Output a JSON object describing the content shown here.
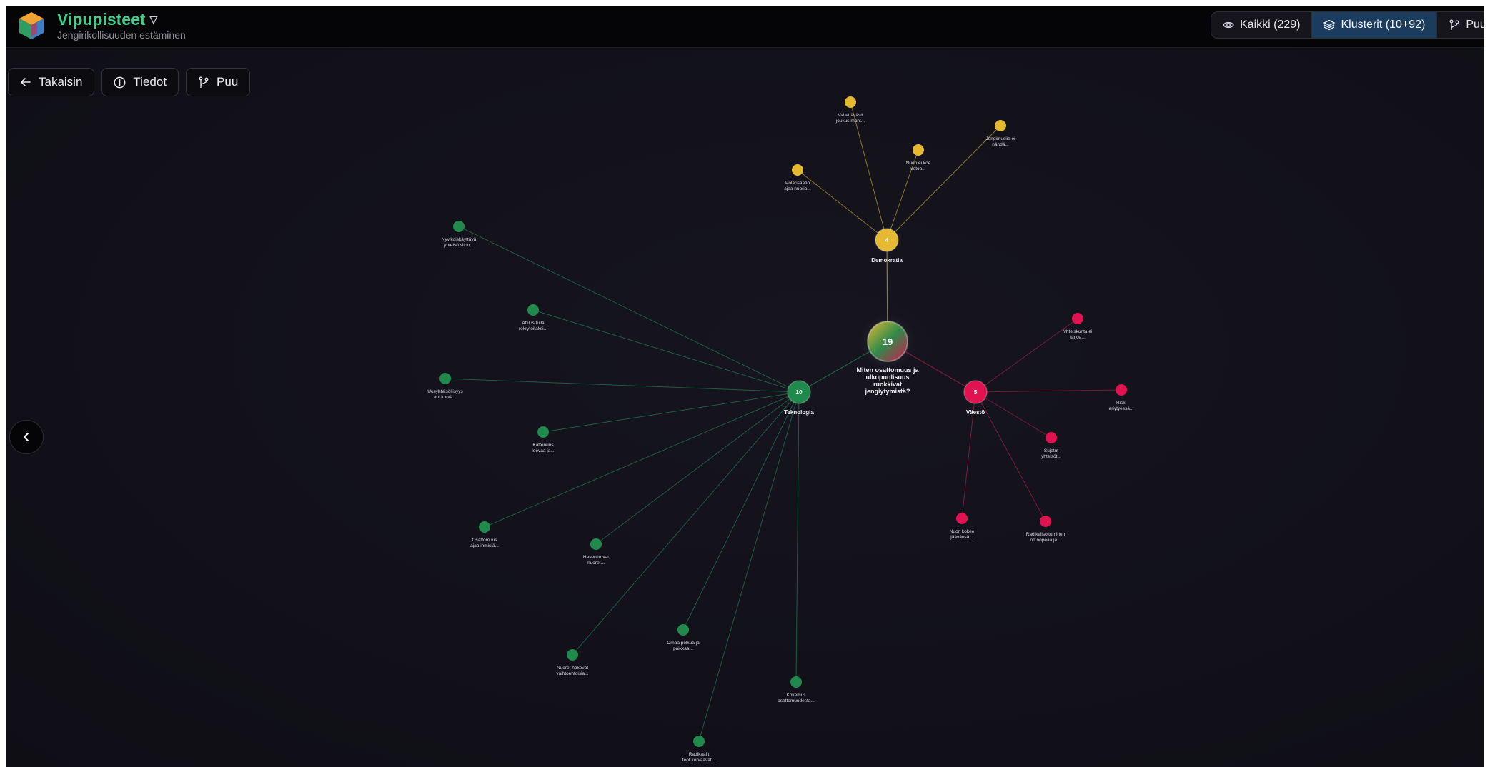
{
  "header": {
    "title": "Vipupisteet",
    "subtitle": "Jengirikollisuuden estäminen"
  },
  "view_tabs": [
    {
      "label": "Kaikki (229)",
      "icon": "eye-icon",
      "active": false
    },
    {
      "label": "Klusterit (10+92)",
      "icon": "layers-icon",
      "active": true
    },
    {
      "label": "Puun",
      "icon": "git-branch-icon",
      "active": false
    }
  ],
  "toolbar": {
    "back_label": "Takaisin",
    "info_label": "Tiedot",
    "tree_label": "Puu"
  },
  "side_toggle": {
    "icon": "chevron-left-icon"
  },
  "colors": {
    "demokratia": "#e6b933",
    "teknologia": "#1f8a4c",
    "vaesto": "#e0124f",
    "edge_green": "#1e6b48",
    "edge_yellow": "#9e8a2e",
    "edge_red": "#8a1d3c"
  },
  "graph": {
    "root": {
      "count": "19",
      "label_lines": [
        "Miten osattomuus ja",
        "ulkopuolisuus",
        "ruokkivat",
        "jengiytymistä?"
      ]
    },
    "hubs": [
      {
        "id": "demokratia",
        "count": "4",
        "label": "Demokratia",
        "color": "#e6b933"
      },
      {
        "id": "teknologia",
        "count": "10",
        "label": "Teknologia",
        "color": "#1f8a4c"
      },
      {
        "id": "vaesto",
        "count": "5",
        "label": "Väestö",
        "color": "#e0124f"
      }
    ],
    "leaves": [
      {
        "hub": "demokratia",
        "lines": [
          "Vaitettävästi",
          "joukus mänt..."
        ]
      },
      {
        "hub": "demokratia",
        "lines": [
          "Jengimusiia ei",
          "nähdä..."
        ]
      },
      {
        "hub": "demokratia",
        "lines": [
          "Nuori ei koe",
          "vetoa..."
        ]
      },
      {
        "hub": "demokratia",
        "lines": [
          "Polarisaatio",
          "ajaa nuoria..."
        ]
      },
      {
        "hub": "teknologia",
        "lines": [
          "Nyvikoiskäyttävä",
          "yhteisö sitoo..."
        ]
      },
      {
        "hub": "teknologia",
        "lines": [
          "Affilus tulla",
          "rekrytoitaksi..."
        ]
      },
      {
        "hub": "teknologia",
        "lines": [
          "Uusyhteisöllisyys",
          "voi korvä..."
        ]
      },
      {
        "hub": "teknologia",
        "lines": [
          "Kattenuus",
          "leevaa ja..."
        ]
      },
      {
        "hub": "teknologia",
        "lines": [
          "Osattomuus",
          "ajaa ihmisiä..."
        ]
      },
      {
        "hub": "teknologia",
        "lines": [
          "Haavoittuvat",
          "nuoret..."
        ]
      },
      {
        "hub": "teknologia",
        "lines": [
          "Omaa polkua ja",
          "paikkaa..."
        ]
      },
      {
        "hub": "teknologia",
        "lines": [
          "Nuoret hakevat",
          "vaihtoehtoisia..."
        ]
      },
      {
        "hub": "teknologia",
        "lines": [
          "Kokemus",
          "osattomuudesta..."
        ]
      },
      {
        "hub": "teknologia",
        "lines": [
          "Radikaalit",
          "teot korvaavat..."
        ]
      },
      {
        "hub": "vaesto",
        "lines": [
          "Yhteiskunta ei",
          "tarjoa..."
        ]
      },
      {
        "hub": "vaesto",
        "lines": [
          "Riski",
          "eriytyessä..."
        ]
      },
      {
        "hub": "vaesto",
        "lines": [
          "Sujetut",
          "yhteisöt..."
        ]
      },
      {
        "hub": "vaesto",
        "lines": [
          "Nuori kokee",
          "jäävänsä..."
        ]
      },
      {
        "hub": "vaesto",
        "lines": [
          "Radikalisoituminen",
          "on nopeaa ja..."
        ]
      }
    ]
  }
}
